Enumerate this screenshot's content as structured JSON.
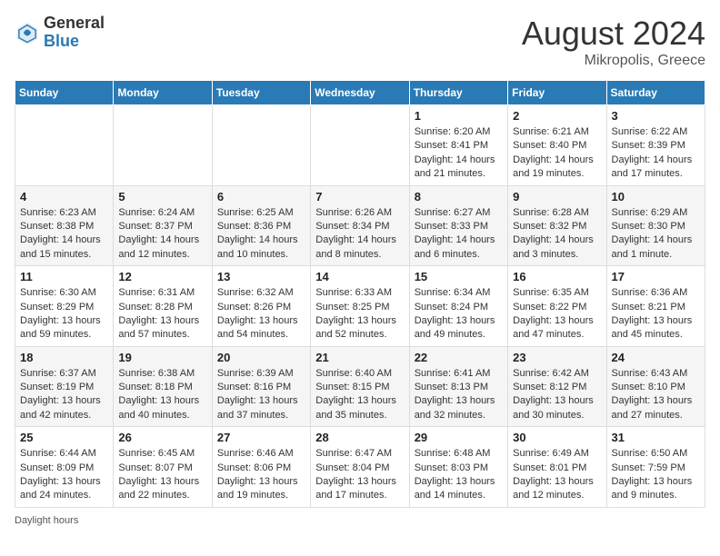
{
  "header": {
    "logo_general": "General",
    "logo_blue": "Blue",
    "month_title": "August 2024",
    "location": "Mikropolis, Greece"
  },
  "days_of_week": [
    "Sunday",
    "Monday",
    "Tuesday",
    "Wednesday",
    "Thursday",
    "Friday",
    "Saturday"
  ],
  "weeks": [
    [
      {
        "date": "",
        "info": ""
      },
      {
        "date": "",
        "info": ""
      },
      {
        "date": "",
        "info": ""
      },
      {
        "date": "",
        "info": ""
      },
      {
        "date": "1",
        "info": "Sunrise: 6:20 AM\nSunset: 8:41 PM\nDaylight: 14 hours and 21 minutes."
      },
      {
        "date": "2",
        "info": "Sunrise: 6:21 AM\nSunset: 8:40 PM\nDaylight: 14 hours and 19 minutes."
      },
      {
        "date": "3",
        "info": "Sunrise: 6:22 AM\nSunset: 8:39 PM\nDaylight: 14 hours and 17 minutes."
      }
    ],
    [
      {
        "date": "4",
        "info": "Sunrise: 6:23 AM\nSunset: 8:38 PM\nDaylight: 14 hours and 15 minutes."
      },
      {
        "date": "5",
        "info": "Sunrise: 6:24 AM\nSunset: 8:37 PM\nDaylight: 14 hours and 12 minutes."
      },
      {
        "date": "6",
        "info": "Sunrise: 6:25 AM\nSunset: 8:36 PM\nDaylight: 14 hours and 10 minutes."
      },
      {
        "date": "7",
        "info": "Sunrise: 6:26 AM\nSunset: 8:34 PM\nDaylight: 14 hours and 8 minutes."
      },
      {
        "date": "8",
        "info": "Sunrise: 6:27 AM\nSunset: 8:33 PM\nDaylight: 14 hours and 6 minutes."
      },
      {
        "date": "9",
        "info": "Sunrise: 6:28 AM\nSunset: 8:32 PM\nDaylight: 14 hours and 3 minutes."
      },
      {
        "date": "10",
        "info": "Sunrise: 6:29 AM\nSunset: 8:30 PM\nDaylight: 14 hours and 1 minute."
      }
    ],
    [
      {
        "date": "11",
        "info": "Sunrise: 6:30 AM\nSunset: 8:29 PM\nDaylight: 13 hours and 59 minutes."
      },
      {
        "date": "12",
        "info": "Sunrise: 6:31 AM\nSunset: 8:28 PM\nDaylight: 13 hours and 57 minutes."
      },
      {
        "date": "13",
        "info": "Sunrise: 6:32 AM\nSunset: 8:26 PM\nDaylight: 13 hours and 54 minutes."
      },
      {
        "date": "14",
        "info": "Sunrise: 6:33 AM\nSunset: 8:25 PM\nDaylight: 13 hours and 52 minutes."
      },
      {
        "date": "15",
        "info": "Sunrise: 6:34 AM\nSunset: 8:24 PM\nDaylight: 13 hours and 49 minutes."
      },
      {
        "date": "16",
        "info": "Sunrise: 6:35 AM\nSunset: 8:22 PM\nDaylight: 13 hours and 47 minutes."
      },
      {
        "date": "17",
        "info": "Sunrise: 6:36 AM\nSunset: 8:21 PM\nDaylight: 13 hours and 45 minutes."
      }
    ],
    [
      {
        "date": "18",
        "info": "Sunrise: 6:37 AM\nSunset: 8:19 PM\nDaylight: 13 hours and 42 minutes."
      },
      {
        "date": "19",
        "info": "Sunrise: 6:38 AM\nSunset: 8:18 PM\nDaylight: 13 hours and 40 minutes."
      },
      {
        "date": "20",
        "info": "Sunrise: 6:39 AM\nSunset: 8:16 PM\nDaylight: 13 hours and 37 minutes."
      },
      {
        "date": "21",
        "info": "Sunrise: 6:40 AM\nSunset: 8:15 PM\nDaylight: 13 hours and 35 minutes."
      },
      {
        "date": "22",
        "info": "Sunrise: 6:41 AM\nSunset: 8:13 PM\nDaylight: 13 hours and 32 minutes."
      },
      {
        "date": "23",
        "info": "Sunrise: 6:42 AM\nSunset: 8:12 PM\nDaylight: 13 hours and 30 minutes."
      },
      {
        "date": "24",
        "info": "Sunrise: 6:43 AM\nSunset: 8:10 PM\nDaylight: 13 hours and 27 minutes."
      }
    ],
    [
      {
        "date": "25",
        "info": "Sunrise: 6:44 AM\nSunset: 8:09 PM\nDaylight: 13 hours and 24 minutes."
      },
      {
        "date": "26",
        "info": "Sunrise: 6:45 AM\nSunset: 8:07 PM\nDaylight: 13 hours and 22 minutes."
      },
      {
        "date": "27",
        "info": "Sunrise: 6:46 AM\nSunset: 8:06 PM\nDaylight: 13 hours and 19 minutes."
      },
      {
        "date": "28",
        "info": "Sunrise: 6:47 AM\nSunset: 8:04 PM\nDaylight: 13 hours and 17 minutes."
      },
      {
        "date": "29",
        "info": "Sunrise: 6:48 AM\nSunset: 8:03 PM\nDaylight: 13 hours and 14 minutes."
      },
      {
        "date": "30",
        "info": "Sunrise: 6:49 AM\nSunset: 8:01 PM\nDaylight: 13 hours and 12 minutes."
      },
      {
        "date": "31",
        "info": "Sunrise: 6:50 AM\nSunset: 7:59 PM\nDaylight: 13 hours and 9 minutes."
      }
    ]
  ],
  "footer": {
    "daylight_label": "Daylight hours"
  }
}
